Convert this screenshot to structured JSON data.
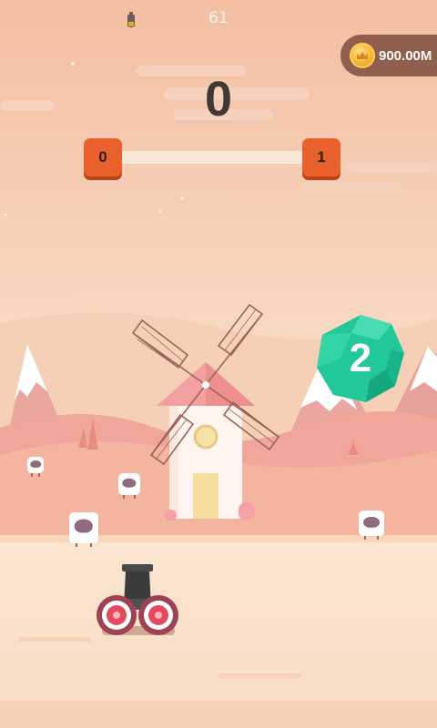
{
  "status": {
    "fps": "61",
    "battery_icon": "battery-icon"
  },
  "hud": {
    "score": "0",
    "coins": "900.00M",
    "coin_icon": "coin-crown-icon"
  },
  "level": {
    "current": "0",
    "next": "1",
    "progress": 0
  },
  "gem_ball": {
    "label": "2",
    "color": "#22c89a"
  },
  "colors": {
    "sky_top": "#f5c6ab",
    "sky_bottom": "#fae0cd",
    "ground": "#fae3cc",
    "level_box": "#e8612c",
    "score_text": "#3f3836",
    "gem": "#22c89a"
  }
}
